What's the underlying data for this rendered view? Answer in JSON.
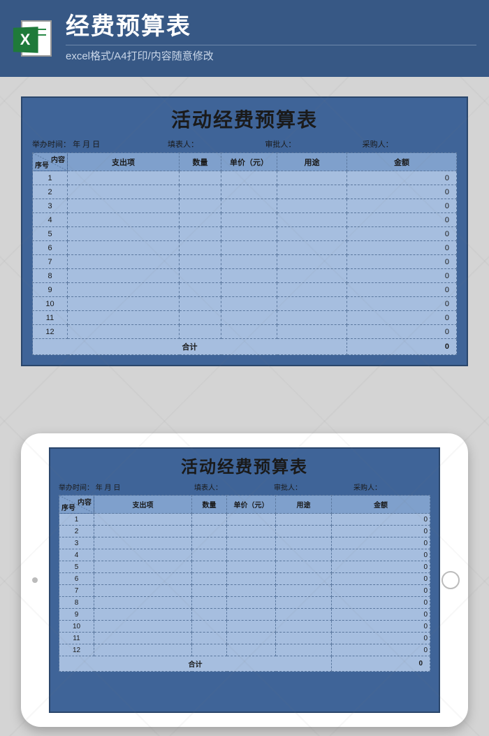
{
  "header": {
    "title": "经费预算表",
    "subtitle": "excel格式/A4打印/内容随意修改",
    "icon_letter": "X"
  },
  "card": {
    "title": "活动经费预算表",
    "meta": {
      "date_label": "举办时间：",
      "date_value": "年  月  日",
      "filler_label": "填表人：",
      "approver_label": "审批人：",
      "purchaser_label": "采购人："
    },
    "columns": {
      "corner_top": "内容",
      "corner_bottom": "序号",
      "item": "支出项",
      "qty": "数量",
      "price": "单价（元）",
      "use": "用途",
      "amount": "金额"
    },
    "rows": [
      {
        "idx": "1",
        "amount": "0"
      },
      {
        "idx": "2",
        "amount": "0"
      },
      {
        "idx": "3",
        "amount": "0"
      },
      {
        "idx": "4",
        "amount": "0"
      },
      {
        "idx": "5",
        "amount": "0"
      },
      {
        "idx": "6",
        "amount": "0"
      },
      {
        "idx": "7",
        "amount": "0"
      },
      {
        "idx": "8",
        "amount": "0"
      },
      {
        "idx": "9",
        "amount": "0"
      },
      {
        "idx": "10",
        "amount": "0"
      },
      {
        "idx": "11",
        "amount": "0"
      },
      {
        "idx": "12",
        "amount": "0"
      }
    ],
    "total_label": "合计",
    "total_amount": "0"
  }
}
